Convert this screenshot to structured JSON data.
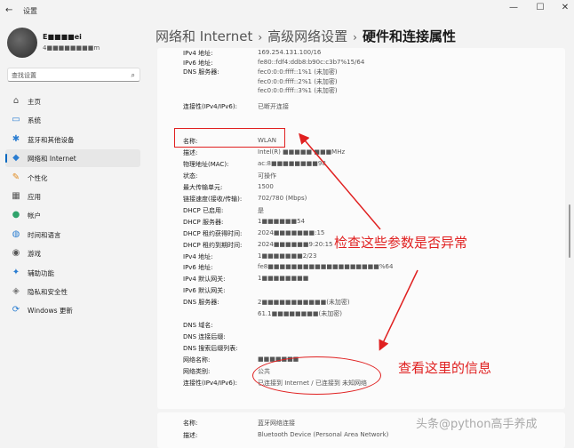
{
  "window": {
    "title": "设置",
    "back_icon": "←",
    "min": "—",
    "max": "☐",
    "close": "✕"
  },
  "user": {
    "name": "E■■■■ei",
    "email": "4■■■■■■■■m"
  },
  "search": {
    "placeholder": "查找设置"
  },
  "nav": [
    {
      "label": "主页",
      "icon": "home-icon",
      "glyph": "⌂",
      "color": "#555"
    },
    {
      "label": "系统",
      "icon": "system-icon",
      "glyph": "▭",
      "color": "#2a7dd1"
    },
    {
      "label": "蓝牙和其他设备",
      "icon": "bluetooth-icon",
      "glyph": "✱",
      "color": "#2a7dd1"
    },
    {
      "label": "网络和 Internet",
      "icon": "network-icon",
      "glyph": "◆",
      "color": "#2a7dd1",
      "selected": true
    },
    {
      "label": "个性化",
      "icon": "brush-icon",
      "glyph": "✎",
      "color": "#e08a1e"
    },
    {
      "label": "应用",
      "icon": "apps-icon",
      "glyph": "▦",
      "color": "#555"
    },
    {
      "label": "帐户",
      "icon": "account-icon",
      "glyph": "●",
      "color": "#2fa36b"
    },
    {
      "label": "时间和语言",
      "icon": "globe-icon",
      "glyph": "◍",
      "color": "#2a7dd1"
    },
    {
      "label": "游戏",
      "icon": "game-icon",
      "glyph": "◉",
      "color": "#555"
    },
    {
      "label": "辅助功能",
      "icon": "accessibility-icon",
      "glyph": "✦",
      "color": "#2a7dd1"
    },
    {
      "label": "隐私和安全性",
      "icon": "shield-icon",
      "glyph": "◈",
      "color": "#777"
    },
    {
      "label": "Windows 更新",
      "icon": "update-icon",
      "glyph": "⟳",
      "color": "#2a7dd1"
    }
  ],
  "breadcrumb": {
    "part1": "网络和 Internet",
    "part2": "高级网络设置",
    "part3": "硬件和连接属性",
    "sep": "›"
  },
  "details_top": [
    {
      "label": "IPv4 地址:",
      "value": "169.254.131.100/16"
    },
    {
      "label": "IPv6 地址:",
      "value": "fe80::fdf4:ddb8:b90c:c3b7%15/64"
    },
    {
      "label": "DNS 服务器:",
      "value": "fec0:0:0:ffff::1%1 (未加密)"
    },
    {
      "label": "",
      "value": "fec0:0:0:ffff::2%1 (未加密)"
    },
    {
      "label": "",
      "value": "fec0:0:0:ffff::3%1 (未加密)"
    },
    {
      "label": "连接性(IPv4/IPv6):",
      "value": "已断开连接"
    }
  ],
  "details_wlan": [
    {
      "label": "名称:",
      "value": "WLAN"
    },
    {
      "label": "描述:",
      "value": "Intel(R) ■■■■■ ■■■MHz"
    },
    {
      "label": "物理地址(MAC):",
      "value": "ac:8■■■■■■■■98"
    },
    {
      "label": "状态:",
      "value": "可操作"
    },
    {
      "label": "最大传输单元:",
      "value": "1500"
    },
    {
      "label": "链接速度(接收/传输):",
      "value": "702/780 (Mbps)"
    },
    {
      "label": "DHCP 已启用:",
      "value": "是"
    },
    {
      "label": "DHCP 服务器:",
      "value": "1■■■■■■54"
    },
    {
      "label": "DHCP 租约获得时间:",
      "value": "2024■■■■■■■:15"
    },
    {
      "label": "DHCP 租约到期时间:",
      "value": "2024■■■■■■9:20:15"
    },
    {
      "label": "IPv4 地址:",
      "value": "1■■■■■■■2/23"
    },
    {
      "label": "IPv6 地址:",
      "value": "fe8■■■■■■■■■■■■■■■■■■■%64"
    },
    {
      "label": "IPv4 默认网关:",
      "value": "1■■■■■■■■"
    },
    {
      "label": "IPv6 默认网关:",
      "value": ""
    },
    {
      "label": "DNS 服务器:",
      "value": "2■■■■■■■■■■■(未加密)"
    },
    {
      "label": "",
      "value": "61.1■■■■■■■■(未加密)"
    },
    {
      "label": "DNS 域名:",
      "value": ""
    },
    {
      "label": "DNS 连接后缀:",
      "value": ""
    },
    {
      "label": "DNS 搜索后缀列表:",
      "value": ""
    },
    {
      "label": "网络名称:",
      "value": "■■■■■■■"
    },
    {
      "label": "网络类别:",
      "value": "公共"
    },
    {
      "label": "连接性(IPv4/IPv6):",
      "value": "已连接到 Internet / 已连接到 未知网络"
    }
  ],
  "details_bt": [
    {
      "label": "名称:",
      "value": "蓝牙网络连接"
    },
    {
      "label": "描述:",
      "value": "Bluetooth Device (Personal Area Network)"
    }
  ],
  "annotations": {
    "check_params": "检查这些参数是否异常",
    "check_info": "查看这里的信息",
    "color": "#e02020"
  },
  "watermark": "头条@python高手养成"
}
